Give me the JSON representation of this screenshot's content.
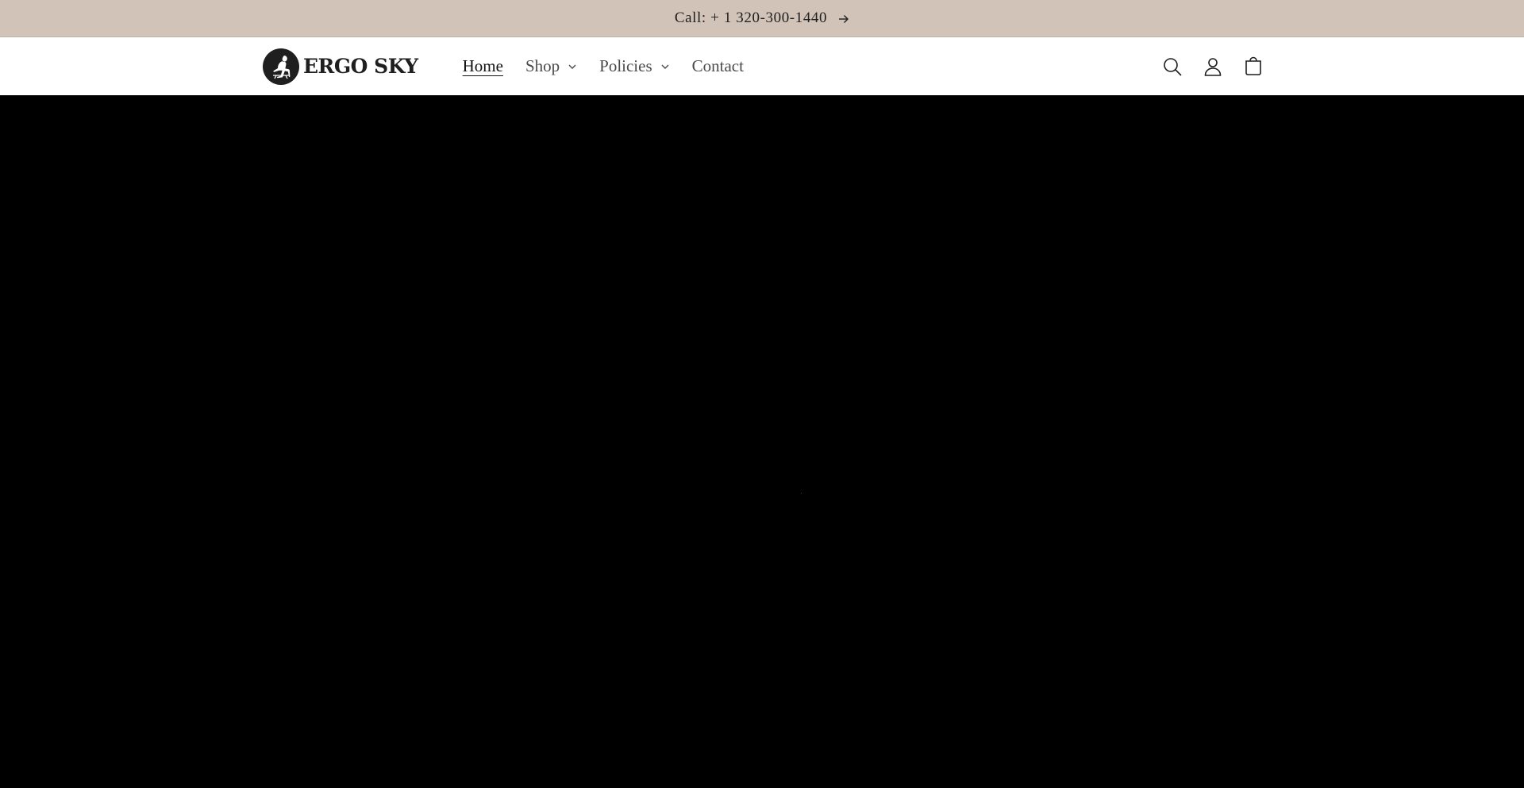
{
  "announcement": {
    "text": "Call: + 1 320-300-1440",
    "icon": "arrow-right-icon"
  },
  "header": {
    "logo_text": "ERGO SKY",
    "nav": [
      {
        "label": "Home",
        "active": true,
        "has_dropdown": false
      },
      {
        "label": "Shop",
        "active": false,
        "has_dropdown": true
      },
      {
        "label": "Policies",
        "active": false,
        "has_dropdown": true
      },
      {
        "label": "Contact",
        "active": false,
        "has_dropdown": false
      }
    ],
    "icons": [
      "search-icon",
      "account-icon",
      "cart-icon"
    ]
  },
  "colors": {
    "announcement_bg": "#d1c3b7",
    "header_bg": "#ffffff",
    "hero_bg": "#000000",
    "text": "#121212"
  }
}
